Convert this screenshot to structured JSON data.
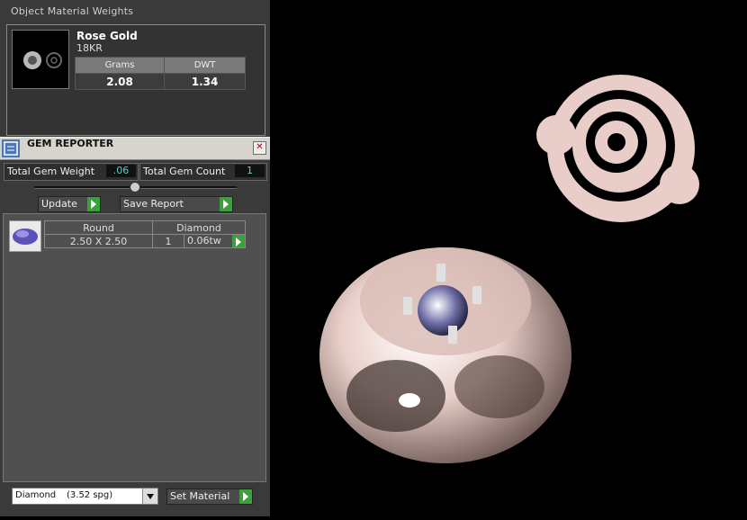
{
  "material_panel": {
    "title": "Object Material Weights",
    "material_name": "Rose Gold",
    "material_karat": "18KR",
    "headers": [
      "Grams",
      "DWT"
    ],
    "values": [
      "2.08",
      "1.34"
    ]
  },
  "gem_reporter": {
    "title": "GEM REPORTER",
    "total_weight_label": "Total Gem Weight",
    "total_weight_value": ".06",
    "total_count_label": "Total Gem Count",
    "total_count_value": "1",
    "update_label": "Update",
    "save_report_label": "Save Report",
    "gems": [
      {
        "shape": "Round",
        "type": "Diamond",
        "size": "2.50 X 2.50",
        "count": "1",
        "weight": "0.06tw"
      }
    ]
  },
  "footer": {
    "material_select_name": "Diamond",
    "material_select_spg": "(3.52 spg)",
    "set_material_label": "Set Material"
  },
  "colors": {
    "panel_bg": "#3a3a3a",
    "viewport_bg": "#000000",
    "accent_green": "#3ca03c",
    "rose_gold": "#e2c7c2"
  }
}
